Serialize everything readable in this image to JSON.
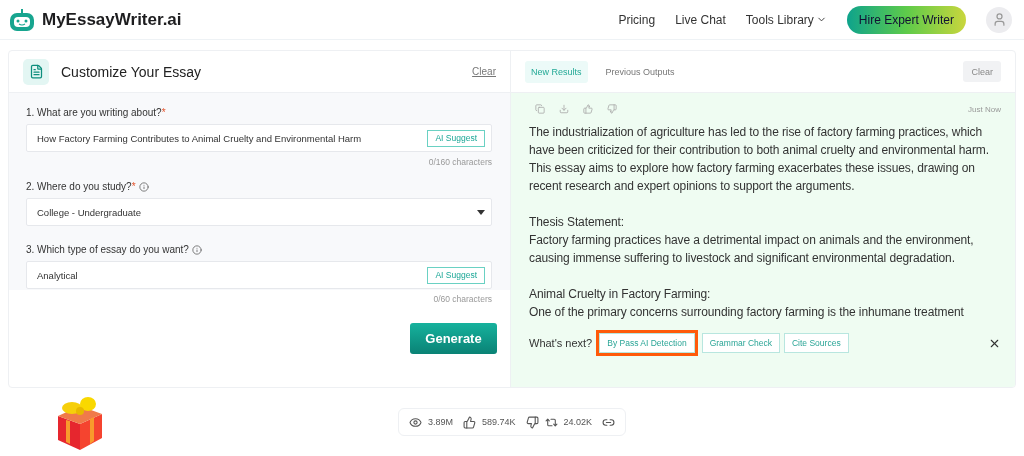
{
  "header": {
    "brand": "MyEssayWriter.ai",
    "nav": [
      {
        "label": "Pricing",
        "kind": "link"
      },
      {
        "label": "Live Chat",
        "kind": "link"
      },
      {
        "label": "Tools Library",
        "kind": "dropdown"
      }
    ],
    "cta": "Hire Expert Writer"
  },
  "form": {
    "title": "Customize Your Essay",
    "clear": "Clear",
    "fields": [
      {
        "kind": "text",
        "label": "1. What are you writing about?",
        "required_mark": "*",
        "info": false,
        "value": "How Factory Farming Contributes to Animal Cruelty and Environmental Harm",
        "suggest": "AI Suggest",
        "counter": "0/160 characters"
      },
      {
        "kind": "select",
        "label": "2. Where do you study?",
        "required_mark": "*",
        "info": true,
        "value": "College - Undergraduate"
      },
      {
        "kind": "text",
        "label": "3. Which type of essay do you want?",
        "info": true,
        "value": "Analytical",
        "suggest": "AI Suggest",
        "counter": "0/60 characters"
      }
    ],
    "generate": "Generate"
  },
  "results": {
    "tabs": [
      {
        "label": "New Results",
        "selected": true
      },
      {
        "label": "Previous Outputs",
        "selected": false
      }
    ],
    "clear": "Clear",
    "time": "Just Now",
    "paragraphs": [
      {
        "kind": "body",
        "text": "The industrialization of agriculture has led to the rise of factory farming practices, which have been criticized for their contribution to both animal cruelty and environmental harm. This essay aims to explore how factory farming exacerbates these issues, drawing on recent research and expert opinions to support the arguments."
      },
      {
        "kind": "heading",
        "text": "Thesis Statement:"
      },
      {
        "kind": "body",
        "text": "Factory farming practices have a detrimental impact on animals and the environment, causing immense suffering to livestock and significant environmental degradation."
      },
      {
        "kind": "heading",
        "text": "Animal Cruelty in Factory Farming:"
      },
      {
        "kind": "body",
        "text": "One of the primary concerns surrounding factory farming is the inhumane treatment"
      }
    ],
    "next_label": "What's next?",
    "next_actions": [
      {
        "label": "By Pass AI Detection",
        "highlighted": true
      },
      {
        "label": "Grammar Check",
        "highlighted": false
      },
      {
        "label": "Cite Sources",
        "highlighted": false
      }
    ]
  },
  "stats": {
    "views": "3.89M",
    "likes": "589.74K",
    "shares": "24.02K"
  }
}
